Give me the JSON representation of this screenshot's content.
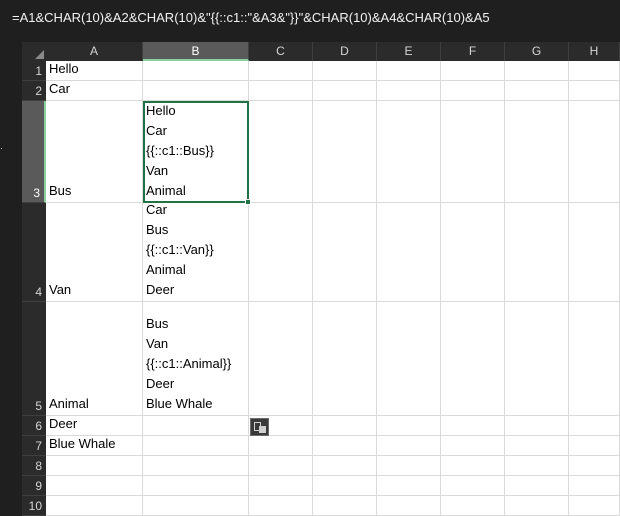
{
  "formula_bar": {
    "formula": "=A1&CHAR(10)&A2&CHAR(10)&\"{{::c1::\"&A3&\"}}\"&CHAR(10)&A4&CHAR(10)&A5"
  },
  "columns": [
    "A",
    "B",
    "C",
    "D",
    "E",
    "F",
    "G",
    "H"
  ],
  "selected_column": "B",
  "selected_row": "3",
  "rows": [
    {
      "num": "1",
      "a": "Hello",
      "b": ""
    },
    {
      "num": "2",
      "a": "Car",
      "b": ""
    },
    {
      "num": "3",
      "a": "Bus",
      "b": "Hello\nCar\n{{::c1::Bus}}\nVan\nAnimal"
    },
    {
      "num": "4",
      "a": "Van",
      "b": "Car\nBus\n{{::c1::Van}}\nAnimal\nDeer"
    },
    {
      "num": "5",
      "a": "Animal",
      "b": "Bus\nVan\n{{::c1::Animal}}\nDeer\nBlue Whale"
    },
    {
      "num": "6",
      "a": "Deer",
      "b": ""
    },
    {
      "num": "7",
      "a": "Blue Whale",
      "b": ""
    },
    {
      "num": "8",
      "a": "",
      "b": ""
    },
    {
      "num": "9",
      "a": "",
      "b": ""
    },
    {
      "num": "10",
      "a": "",
      "b": ""
    }
  ],
  "icons": {
    "paste_options": "paste-options-icon",
    "select_all": "select-all-triangle-icon"
  },
  "colors": {
    "selection_border": "#217346",
    "header_bg": "#2b2b2b",
    "header_selected_bg": "#5a5a5a"
  }
}
